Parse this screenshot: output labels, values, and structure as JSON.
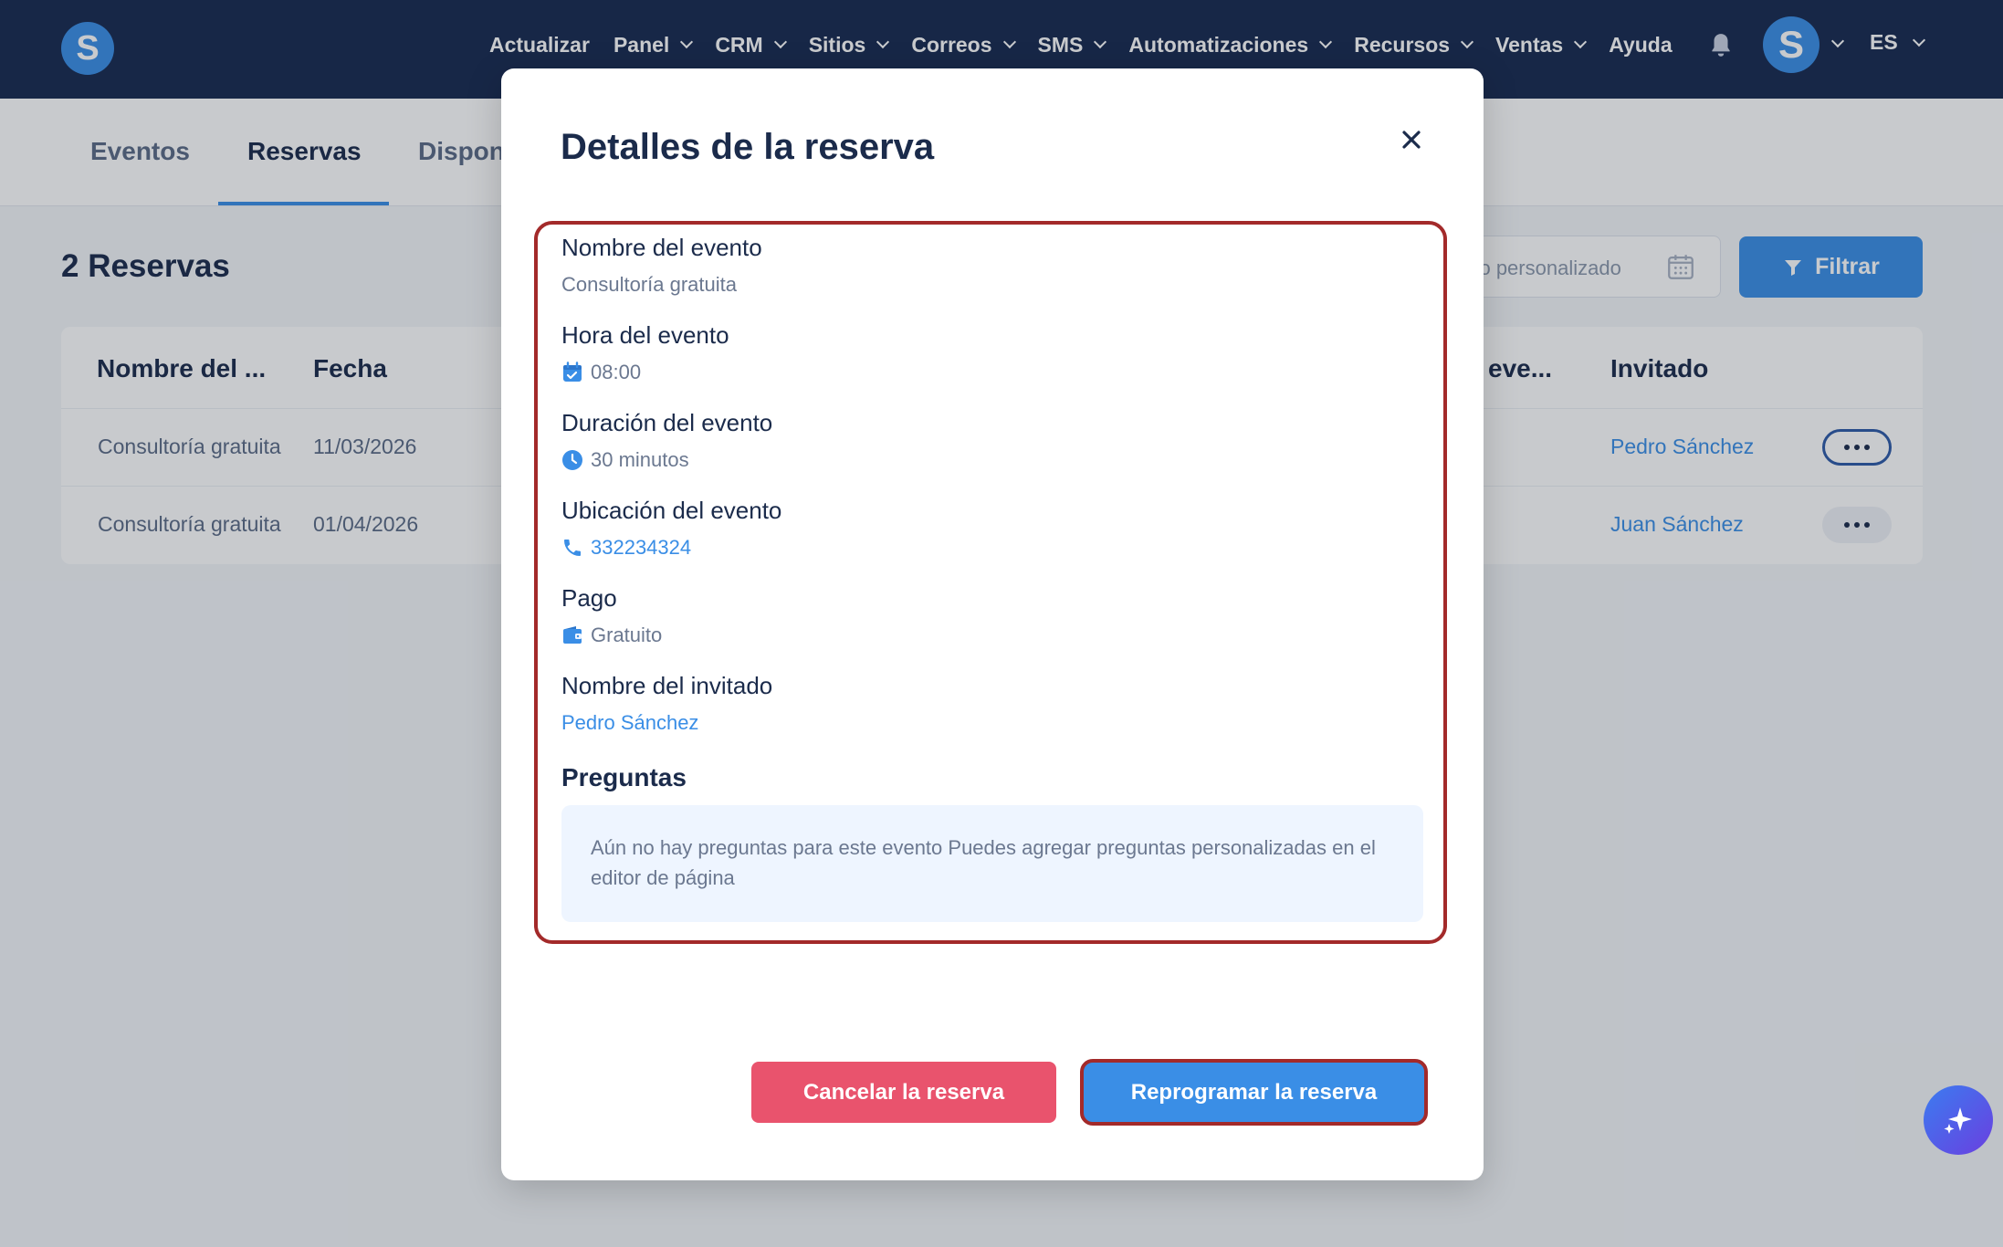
{
  "nav": {
    "logo_letter": "S",
    "items": [
      {
        "label": "Actualizar",
        "dropdown": false
      },
      {
        "label": "Panel",
        "dropdown": true
      },
      {
        "label": "CRM",
        "dropdown": true
      },
      {
        "label": "Sitios",
        "dropdown": true
      },
      {
        "label": "Correos",
        "dropdown": true
      },
      {
        "label": "SMS",
        "dropdown": true
      },
      {
        "label": "Automatizaciones",
        "dropdown": true
      },
      {
        "label": "Recursos",
        "dropdown": true
      },
      {
        "label": "Ventas",
        "dropdown": true
      },
      {
        "label": "Ayuda",
        "dropdown": false
      }
    ],
    "avatar_letter": "S",
    "language": "ES",
    "icons": [
      "bell-icon",
      "chevron-down-icon"
    ]
  },
  "tabs": [
    {
      "label": "Eventos",
      "active": false
    },
    {
      "label": "Reservas",
      "active": true
    },
    {
      "label": "Dispon",
      "active": false
    }
  ],
  "page": {
    "title": "2 Reservas",
    "date_range_text": "ngo personalizado",
    "filter_label": "Filtrar"
  },
  "table": {
    "headers": [
      "Nombre del ...",
      "Fecha",
      "eve...",
      "Invitado"
    ],
    "rows": [
      {
        "event": "Consultoría gratuita",
        "date": "11/03/2026",
        "guest": "Pedro Sánchez"
      },
      {
        "event": "Consultoría gratuita",
        "date": "01/04/2026",
        "guest": "Juan Sánchez"
      }
    ]
  },
  "modal": {
    "title": "Detalles de la reserva",
    "fields": {
      "event_name": {
        "label": "Nombre del evento",
        "value": "Consultoría gratuita"
      },
      "event_time": {
        "label": "Hora del evento",
        "value": "08:00",
        "icon": "calendar-check-icon"
      },
      "event_duration": {
        "label": "Duración del evento",
        "value": "30 minutos",
        "icon": "clock-icon"
      },
      "event_location": {
        "label": "Ubicación del evento",
        "value": "332234324",
        "icon": "phone-icon"
      },
      "payment": {
        "label": "Pago",
        "value": "Gratuito",
        "icon": "wallet-icon"
      },
      "guest_name": {
        "label": "Nombre del invitado",
        "value": "Pedro Sánchez"
      }
    },
    "questions_title": "Preguntas",
    "questions_empty": "Aún no hay preguntas para este evento Puedes agregar preguntas personalizadas en el editor de página",
    "cancel_label": "Cancelar la reserva",
    "reschedule_label": "Reprogramar la reserva"
  },
  "colors": {
    "nav_bg": "#17294f",
    "accent": "#3a8ee6",
    "danger": "#e9536d",
    "highlight_border": "#a32a2a"
  }
}
